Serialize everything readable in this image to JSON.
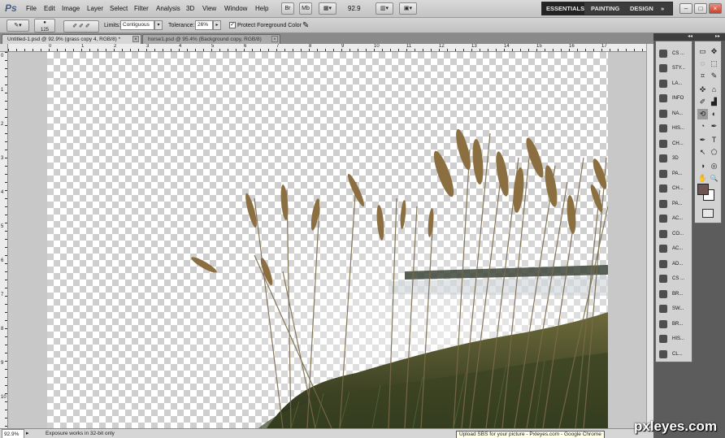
{
  "app": {
    "logo": "Ps"
  },
  "menu": [
    "File",
    "Edit",
    "Image",
    "Layer",
    "Select",
    "Filter",
    "Analysis",
    "3D",
    "View",
    "Window",
    "Help"
  ],
  "menubar_controls": {
    "zoom_value": "92.9"
  },
  "workspaces": {
    "items": [
      "ESSENTIALS",
      "PAINTING",
      "DESIGN"
    ],
    "active": "ESSENTIALS",
    "more": "»"
  },
  "window_buttons": [
    "–",
    "□",
    "×"
  ],
  "options": {
    "brush_size": "125",
    "limits_label": "Limits:",
    "limits_value": "Contiguous",
    "tolerance_label": "Tolerance:",
    "tolerance_value": "26%",
    "protect_label": "Protect Foreground Color",
    "protect_checked": true
  },
  "tabs": [
    {
      "label": "Untitled-1.psd @ 92.9% (grass copy 4, RGB/8) *",
      "active": true
    },
    {
      "label": "horse1.psd @ 95.4% (Background copy, RGB/8)",
      "active": false
    }
  ],
  "ruler": {
    "h_labels": [
      "0",
      "1",
      "2",
      "3",
      "4",
      "5",
      "6",
      "7",
      "8",
      "9",
      "10",
      "11",
      "12",
      "13",
      "14",
      "15",
      "16",
      "17"
    ],
    "v_labels": [
      "0",
      "1",
      "2",
      "3",
      "4",
      "5",
      "6",
      "7",
      "8",
      "9",
      "10"
    ]
  },
  "status": {
    "zoom": "92.9%",
    "info": "Exposure works in 32-bit only"
  },
  "tooltip": "Upload SBS for your picture - Pxleyes.com - Google Chrome",
  "watermark": "pxleyes.com",
  "dock": {
    "collapse": "◂◂",
    "expand": "▸▸"
  },
  "panels": [
    "CS ...",
    "STY...",
    "LA...",
    "INFO",
    "NA...",
    "HIS...",
    "CH...",
    "3D",
    "PA...",
    "CH...",
    "PA...",
    "AC...",
    "CO...",
    "AC...",
    "AD...",
    "CS ...",
    "BR...",
    "SW...",
    "BR...",
    "HIS...",
    "CL..."
  ],
  "tools": [
    "▭",
    "✥",
    "◌",
    "⬚",
    "⌗",
    "✎",
    "✜",
    "⌂",
    "✐",
    "▟",
    "⟲",
    "◐",
    "◔",
    "✒",
    "T",
    "↖",
    "⬠",
    "✋",
    "🔍"
  ],
  "colors": {
    "foreground": "#6b5651",
    "background": "#ffffff",
    "accent": "#232323"
  }
}
